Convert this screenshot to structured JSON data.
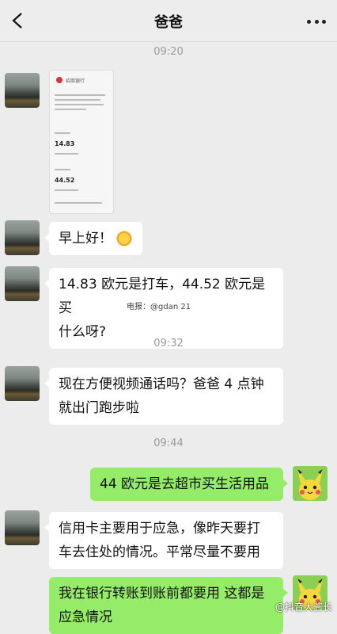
{
  "header": {
    "title": "爸爸"
  },
  "messages": {
    "time1": "09:20",
    "greeting": "早上好！",
    "question": "14.83 欧元是打车，44.52 欧元是买什么呀?",
    "question_l1": "14.83 欧元是打车，44.52 欧元是买",
    "question_l2": "什么呀?",
    "time2": "09:32",
    "video_l1": "现在方便视频通话吗？爸爸 4 点钟",
    "video_l2": "就出门跑步啦",
    "time3": "09:44",
    "reply1": "44 欧元是去超市买生活用品",
    "credit_l1": "信用卡主要用于应急，像昨天要打",
    "credit_l2": "车去住处的情况。平常尽量不要用",
    "reply2_l1": "我在银行转账到账前都要用 这都是",
    "reply2_l2": "应急情况"
  },
  "screenshot_image": {
    "bank": "招商银行",
    "amount1": "14.83",
    "amount2": "44.52"
  },
  "watermarks": {
    "middle": "电报：@gdan 21",
    "bottom": "@抖音大酱长"
  },
  "colors": {
    "chat_bg": "#ececec",
    "bubble_left": "#ffffff",
    "bubble_right": "#95ec69",
    "time_text": "#9a9a9a"
  },
  "icons": [
    "back-icon",
    "more-icon",
    "sun-emoji-icon"
  ]
}
